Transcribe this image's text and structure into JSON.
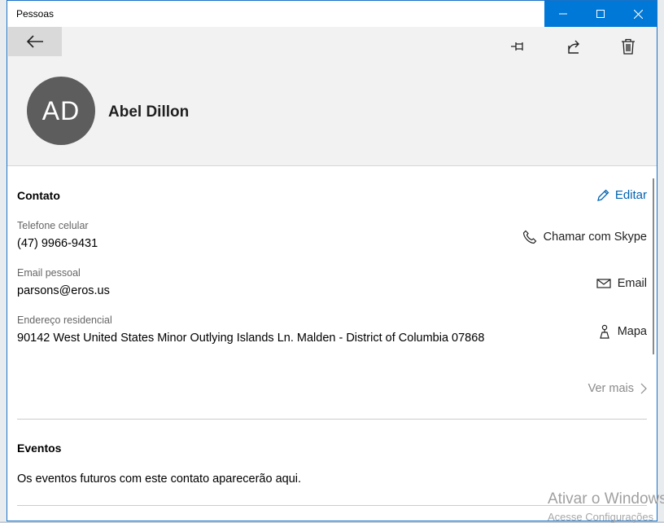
{
  "window": {
    "title": "Pessoas"
  },
  "contact": {
    "initials": "AD",
    "name": "Abel Dillon"
  },
  "contact_section": {
    "title": "Contato",
    "edit_label": "Editar",
    "fields": [
      {
        "label": "Telefone celular",
        "value": "(47) 9966-9431",
        "action": "Chamar com Skype",
        "icon": "phone-icon"
      },
      {
        "label": "Email pessoal",
        "value": "parsons@eros.us",
        "action": "Email",
        "icon": "mail-icon"
      },
      {
        "label": "Endereço residencial",
        "value": "90142 West United States Minor Outlying Islands Ln. Malden - District of Columbia 07868",
        "action": "Mapa",
        "icon": "map-icon"
      }
    ],
    "see_more": "Ver mais"
  },
  "events_section": {
    "title": "Eventos",
    "empty_text": "Os eventos futuros com este contato aparecerão aqui."
  },
  "watermark": {
    "line1": "Ativar o Windows",
    "line2": "Acesse Configurações"
  },
  "colors": {
    "accent": "#0078d7",
    "link": "#0063b1",
    "avatar": "#5d5d5d"
  }
}
